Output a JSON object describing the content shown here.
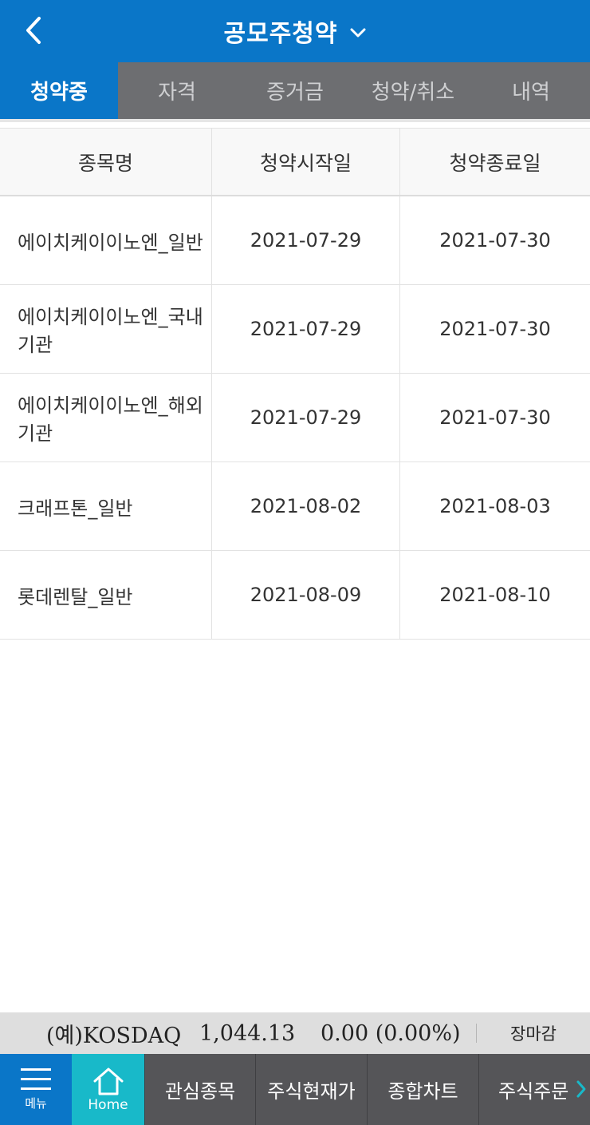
{
  "header": {
    "title": "공모주청약",
    "back_icon": "chevron-left-icon",
    "dropdown_icon": "chevron-down-icon"
  },
  "tabs": [
    {
      "label": "청약중",
      "active": true
    },
    {
      "label": "자격",
      "active": false
    },
    {
      "label": "증거금",
      "active": false
    },
    {
      "label": "청약/취소",
      "active": false
    },
    {
      "label": "내역",
      "active": false
    }
  ],
  "table": {
    "columns": [
      "종목명",
      "청약시작일",
      "청약종료일"
    ],
    "rows": [
      {
        "name": "에이치케이이노엔_일반",
        "start": "2021-07-29",
        "end": "2021-07-30"
      },
      {
        "name": "에이치케이이노엔_국내기관",
        "start": "2021-07-29",
        "end": "2021-07-30"
      },
      {
        "name": "에이치케이이노엔_해외기관",
        "start": "2021-07-29",
        "end": "2021-07-30"
      },
      {
        "name": "크래프톤_일반",
        "start": "2021-08-02",
        "end": "2021-08-03"
      },
      {
        "name": "롯데렌탈_일반",
        "start": "2021-08-09",
        "end": "2021-08-10"
      }
    ]
  },
  "ticker": {
    "name": "(예)KOSDAQ",
    "value": "1,044.13",
    "change": "0.00 (0.00%)",
    "status": "장마감"
  },
  "bottom_nav": {
    "menu_label": "메뉴",
    "home_label": "Home",
    "items": [
      "관심종목",
      "주식현재가",
      "종합차트",
      "주식주문"
    ]
  },
  "colors": {
    "primary": "#0a76c8",
    "home": "#18b9c9",
    "tab_bg": "#6d6e71",
    "nav_bg": "#555558"
  }
}
